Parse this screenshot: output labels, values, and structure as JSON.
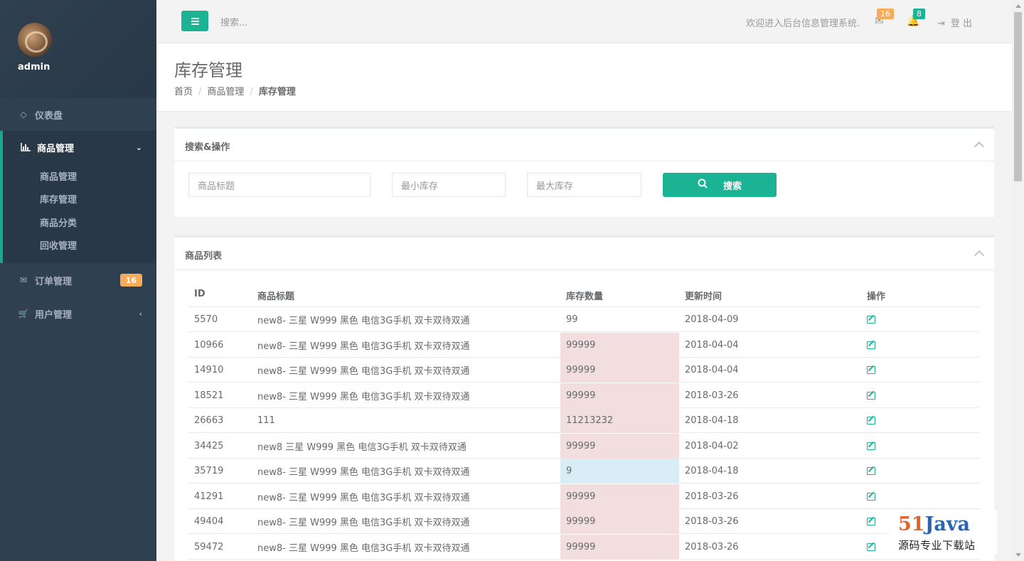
{
  "sidebar": {
    "user": "admin",
    "items": [
      {
        "label": "仪表盘",
        "icon": "diamond-icon"
      },
      {
        "label": "商品管理",
        "icon": "bar-chart-icon"
      },
      {
        "label": "订单管理",
        "icon": "envelope-icon",
        "badge": "16"
      },
      {
        "label": "用户管理",
        "icon": "cart-icon"
      }
    ],
    "sub_items": [
      "商品管理",
      "库存管理",
      "商品分类",
      "回收管理"
    ]
  },
  "topbar": {
    "search_placeholder": "搜索...",
    "welcome": "欢迎进入后台信息管理系统.",
    "mail_count": "16",
    "bell_count": "8",
    "logout": "登 出"
  },
  "page": {
    "title": "库存管理",
    "breadcrumb": [
      "首页",
      "商品管理",
      "库存管理"
    ]
  },
  "search_panel": {
    "title": "搜索&操作",
    "title_placeholder": "商品标题",
    "min_placeholder": "最小库存",
    "max_placeholder": "最大库存",
    "button": "搜索"
  },
  "list_panel": {
    "title": "商品列表",
    "columns": [
      "ID",
      "商品标题",
      "库存数量",
      "更新时间",
      "操作"
    ],
    "rows": [
      {
        "id": "5570",
        "title": "new8- 三星 W999 黑色 电信3G手机 双卡双待双通",
        "stock": "99",
        "updated": "2018-04-09",
        "status": "none"
      },
      {
        "id": "10966",
        "title": "new8- 三星 W999 黑色 电信3G手机 双卡双待双通",
        "stock": "99999",
        "updated": "2018-04-04",
        "status": "danger"
      },
      {
        "id": "14910",
        "title": "new8- 三星 W999 黑色 电信3G手机 双卡双待双通",
        "stock": "99999",
        "updated": "2018-04-04",
        "status": "danger"
      },
      {
        "id": "18521",
        "title": "new8- 三星 W999 黑色 电信3G手机 双卡双待双通",
        "stock": "99999",
        "updated": "2018-03-26",
        "status": "danger"
      },
      {
        "id": "26663",
        "title": "111",
        "stock": "11213232",
        "updated": "2018-04-18",
        "status": "danger"
      },
      {
        "id": "34425",
        "title": "new8 三星 W999 黑色 电信3G手机 双卡双待双通",
        "stock": "99999",
        "updated": "2018-04-02",
        "status": "danger"
      },
      {
        "id": "35719",
        "title": "new8- 三星 W999 黑色 电信3G手机 双卡双待双通",
        "stock": "9",
        "updated": "2018-04-18",
        "status": "info"
      },
      {
        "id": "41291",
        "title": "new8- 三星 W999 黑色 电信3G手机 双卡双待双通",
        "stock": "99999",
        "updated": "2018-03-26",
        "status": "danger"
      },
      {
        "id": "49404",
        "title": "new8- 三星 W999 黑色 电信3G手机 双卡双待双通",
        "stock": "99999",
        "updated": "2018-03-26",
        "status": "danger"
      },
      {
        "id": "59472",
        "title": "new8- 三星 W999 黑色 电信3G手机 双卡双待双通",
        "stock": "99999",
        "updated": "2018-03-26",
        "status": "danger"
      }
    ]
  },
  "colors": {
    "accent": "#1ab394",
    "sidebar_bg": "#2f4050",
    "danger_cell": "#f2dede",
    "info_cell": "#d9edf7",
    "badge_warning": "#f8ac59"
  },
  "watermark": {
    "line1_a": "51",
    "line1_b": "Java",
    "line2": "源码专业下载站"
  }
}
